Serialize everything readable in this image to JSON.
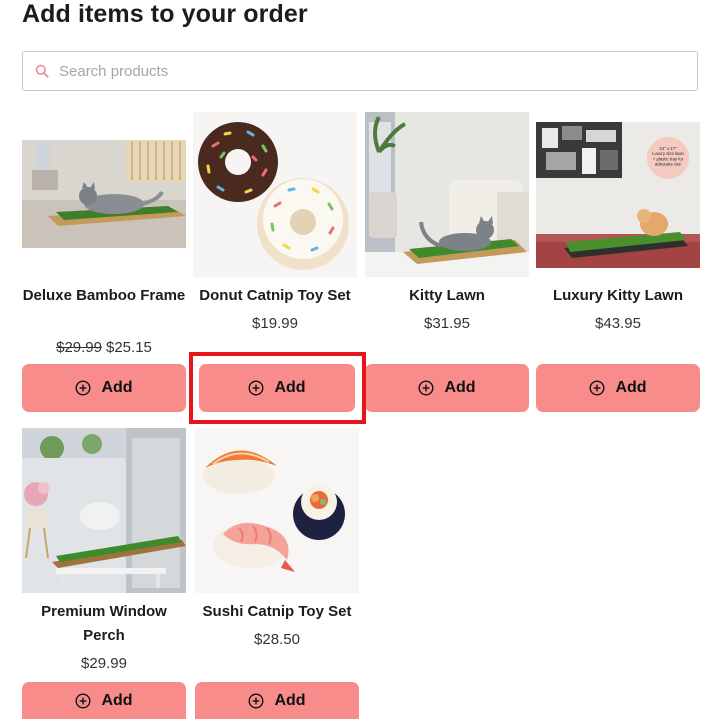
{
  "header": {
    "title": "Add items to your order"
  },
  "search": {
    "placeholder": "Search products",
    "value": "",
    "icon": "search-icon"
  },
  "products": [
    {
      "name": "Deluxe Bamboo Frame",
      "original_price": "$29.99",
      "price": "$25.15",
      "add_label": "Add"
    },
    {
      "name": "Donut Catnip Toy Set",
      "price": "$19.99",
      "add_label": "Add"
    },
    {
      "name": "Kitty Lawn",
      "price": "$31.95",
      "add_label": "Add"
    },
    {
      "name": "Luxury Kitty Lawn",
      "price": "$43.95",
      "add_label": "Add"
    },
    {
      "name": "Premium Window Perch",
      "price": "$29.99",
      "add_label": "Add"
    },
    {
      "name": "Sushi Catnip Toy Set",
      "price": "$28.50",
      "add_label": "Add"
    }
  ],
  "product_image_text": {
    "luxury_sign": "24\" x 17\" Luxury size lawn + plastic tray for adequate use"
  },
  "colors": {
    "accent_button": "#f78c8a",
    "highlight_outline": "#e8141c",
    "search_icon": "#e88a8a"
  }
}
